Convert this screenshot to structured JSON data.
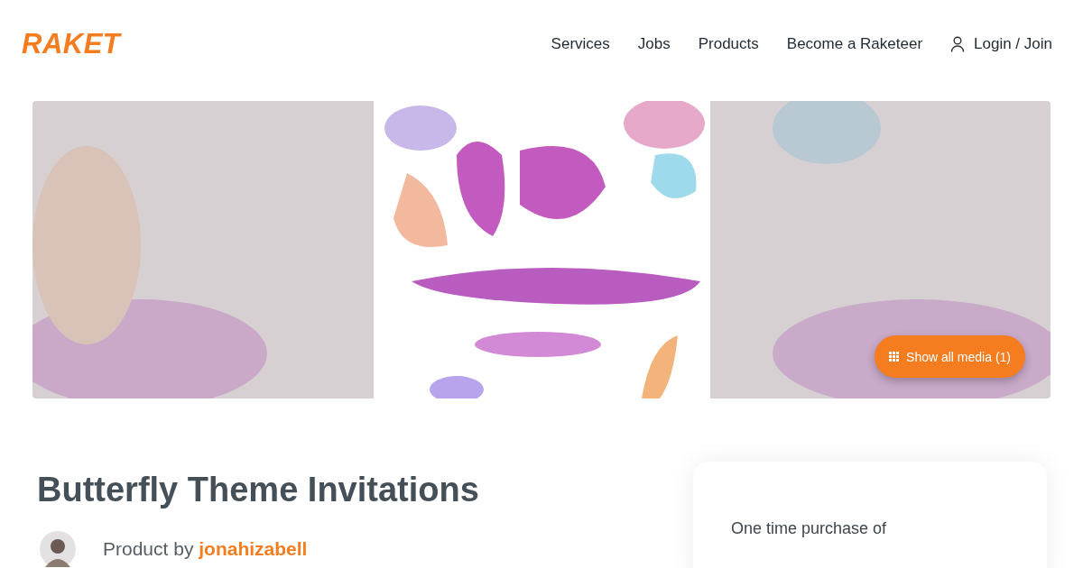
{
  "header": {
    "logo": "RAKET",
    "nav": [
      {
        "label": "Services"
      },
      {
        "label": "Jobs"
      },
      {
        "label": "Products"
      },
      {
        "label": "Become a Raketeer"
      }
    ],
    "login": "Login / Join"
  },
  "hero": {
    "kind": "picture",
    "media_button": "Show all media (1)"
  },
  "product": {
    "title": "Butterfly Theme Invitations",
    "by_label": "Product by",
    "seller": "jonahizabell"
  },
  "purchase_card": {
    "label": "One time purchase of"
  }
}
